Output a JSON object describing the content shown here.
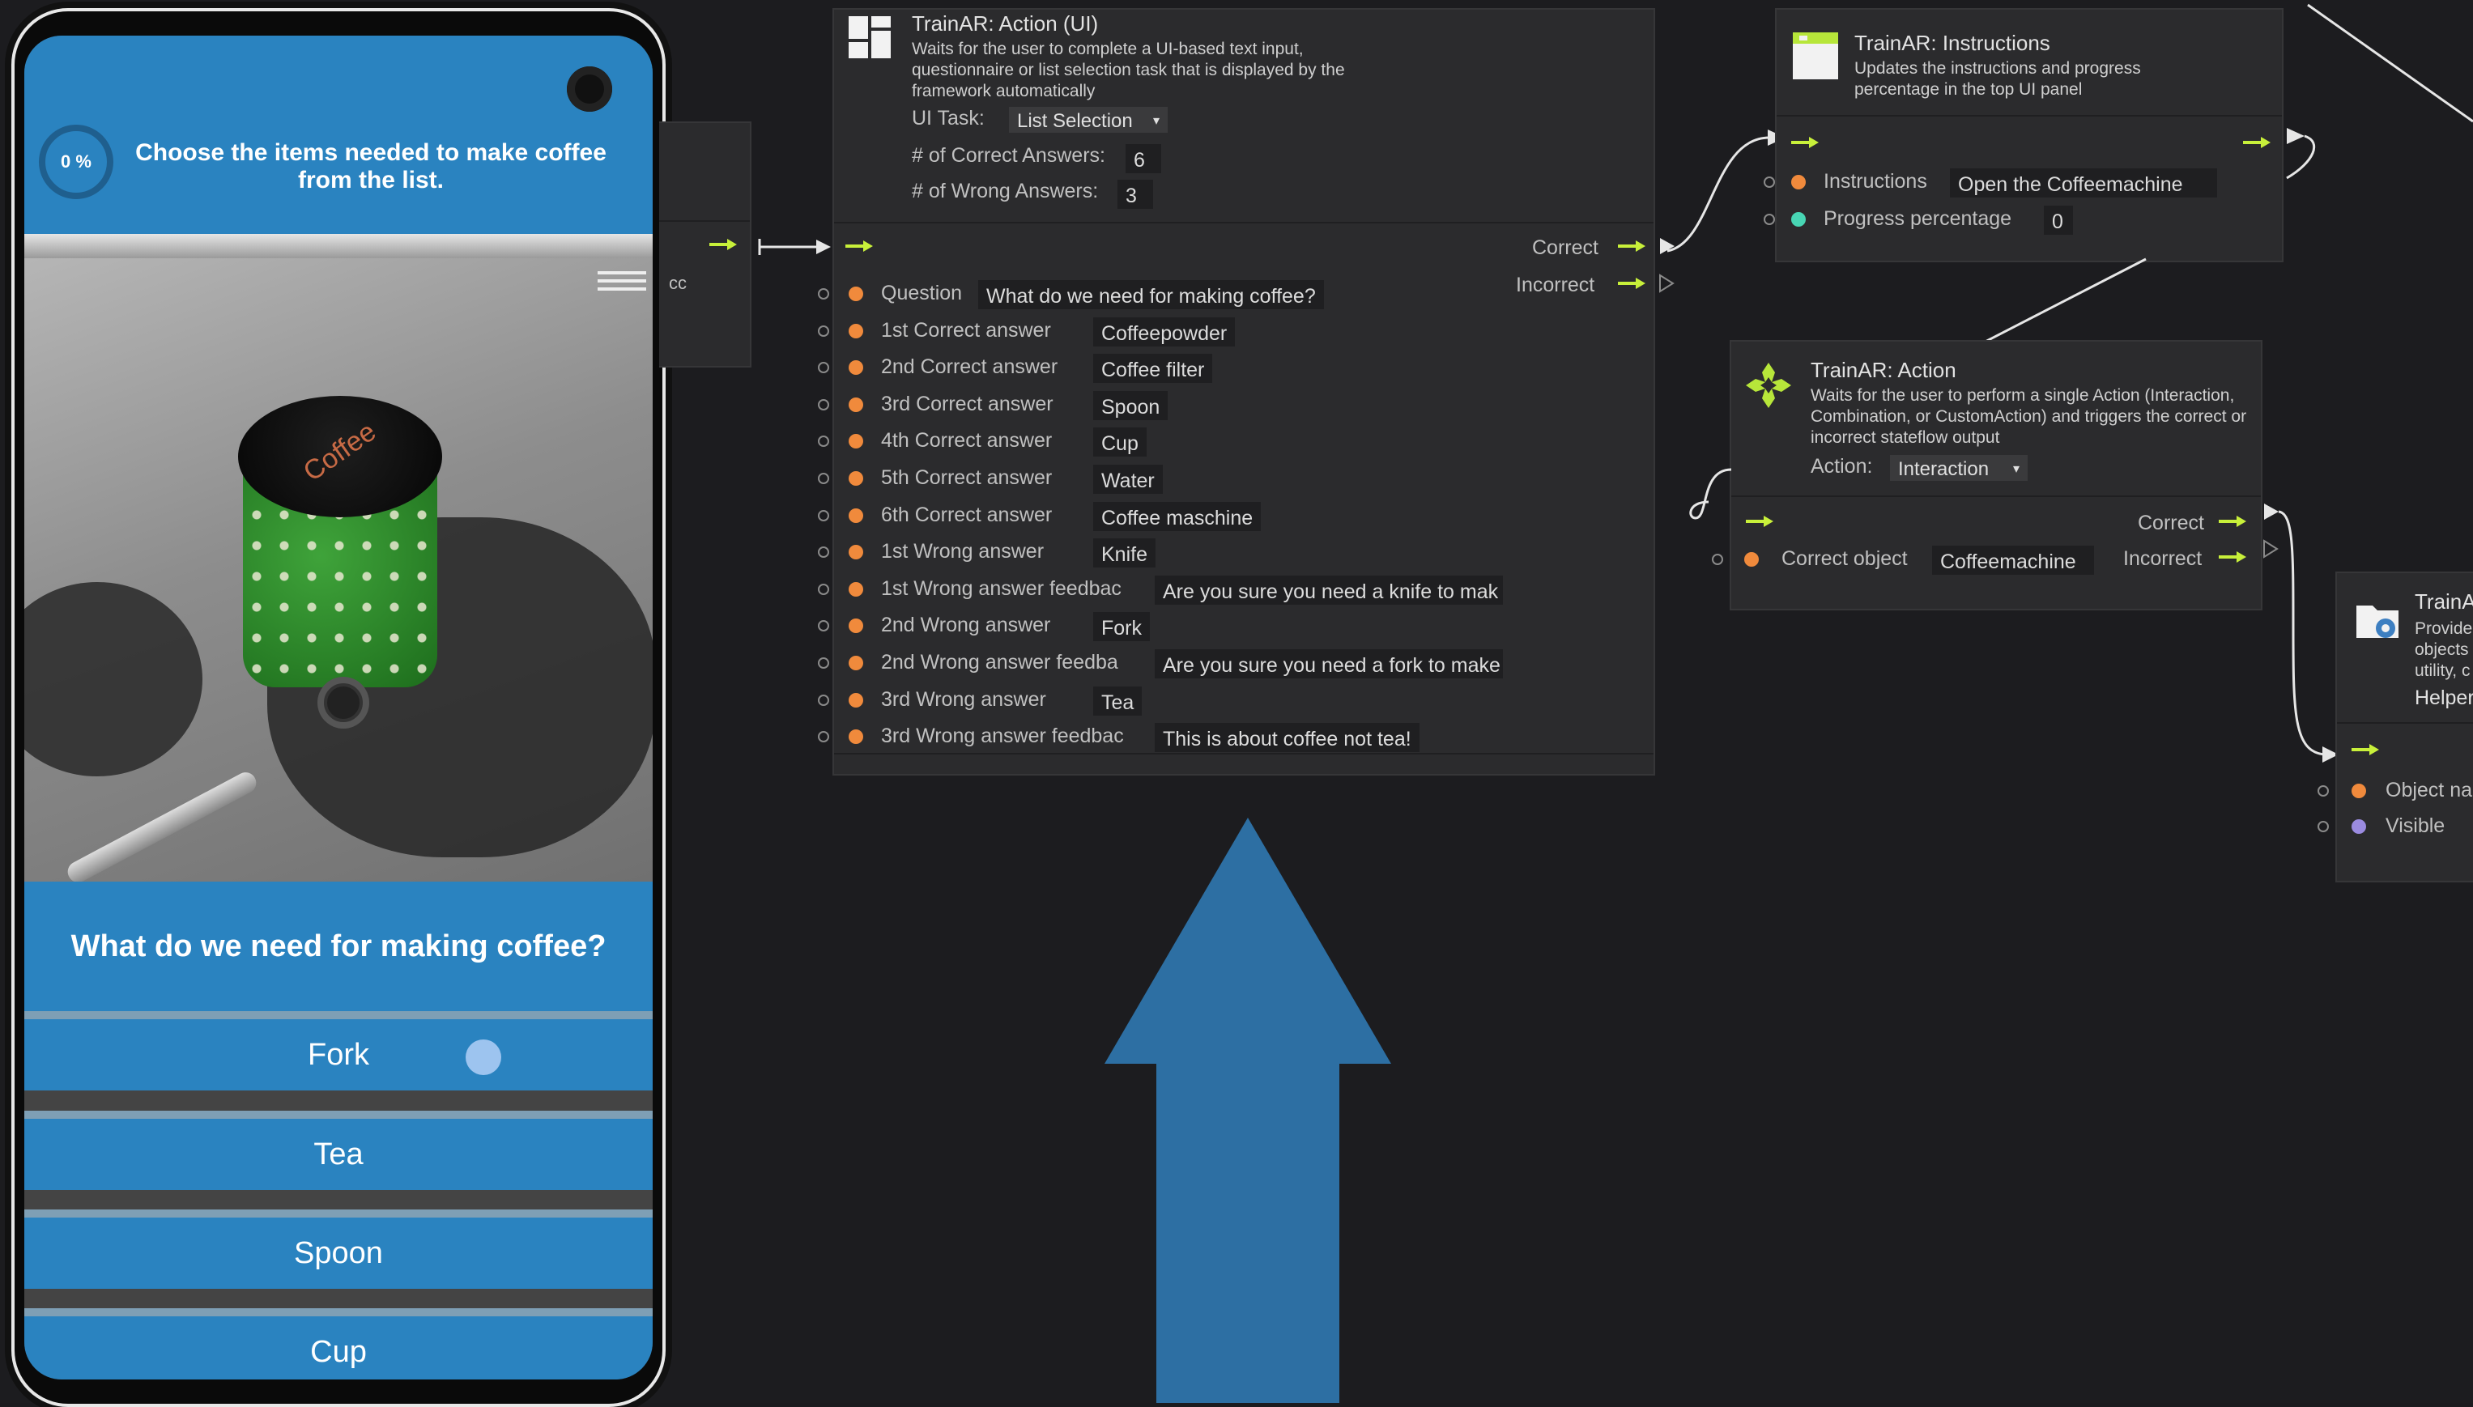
{
  "phone": {
    "progress": "0 %",
    "instruction": "Choose the items needed to make coffee from the list.",
    "jar_label": "Coffee",
    "question": "What do we need for making coffee?",
    "options": [
      "Fork",
      "Tea",
      "Spoon",
      "Cup"
    ]
  },
  "ui_node": {
    "title": "TrainAR: Action (UI)",
    "description": "Waits for the user to complete a UI-based text input, questionnaire or list selection task that is displayed by the framework automatically",
    "ui_task_label": "UI Task:",
    "ui_task_value": "List Selection",
    "correct_count_label": "# of Correct Answers:",
    "correct_count_value": "6",
    "wrong_count_label": "# of Wrong Answers:",
    "wrong_count_value": "3",
    "out_correct": "Correct",
    "out_incorrect": "Incorrect",
    "rows": [
      {
        "label": "Question",
        "value": "What do we need for making coffee?"
      },
      {
        "label": "1st Correct answer",
        "value": "Coffeepowder"
      },
      {
        "label": "2nd Correct answer",
        "value": "Coffee filter"
      },
      {
        "label": "3rd Correct answer",
        "value": "Spoon"
      },
      {
        "label": "4th Correct answer",
        "value": "Cup"
      },
      {
        "label": "5th Correct answer",
        "value": "Water"
      },
      {
        "label": "6th Correct answer",
        "value": "Coffee maschine"
      },
      {
        "label": "1st Wrong answer",
        "value": "Knife"
      },
      {
        "label": "1st Wrong answer feedbac",
        "value": "Are you sure you need a knife to mak"
      },
      {
        "label": "2nd Wrong answer",
        "value": "Fork"
      },
      {
        "label": "2nd Wrong answer feedba",
        "value": "Are you sure you need a fork to make"
      },
      {
        "label": "3rd Wrong answer",
        "value": "Tea"
      },
      {
        "label": "3rd Wrong answer feedbac",
        "value": "This is about coffee not tea!"
      }
    ]
  },
  "left_node_partial": {
    "text": "cc"
  },
  "instructions_node": {
    "title": "TrainAR: Instructions",
    "description": "Updates the instructions and progress percentage in the top UI panel",
    "instructions_label": "Instructions",
    "instructions_value": "Open the Coffeemachine",
    "progress_label": "Progress percentage",
    "progress_value": "0"
  },
  "action_node": {
    "title": "TrainAR: Action",
    "description": "Waits for the user to perform a single Action (Interaction, Combination, or CustomAction) and triggers the correct or incorrect stateflow output",
    "action_label": "Action:",
    "action_value": "Interaction",
    "correct_object_label": "Correct object",
    "correct_object_value": "Coffeemachine",
    "out_correct": "Correct",
    "out_incorrect": "Incorrect"
  },
  "helper_node": {
    "title": "TrainA",
    "description_lines": [
      "Provide",
      "objects",
      "utility, c"
    ],
    "subtitle": "Helper",
    "object_label": "Object na",
    "visible_label": "Visible"
  },
  "colors": {
    "phone_blue": "#2a83c0",
    "flow_green": "#c8f03a",
    "object_port": "#f08a3c",
    "text_port": "#48d6b4",
    "bool_port": "#9b8be0",
    "big_arrow": "#2d6fa3"
  }
}
